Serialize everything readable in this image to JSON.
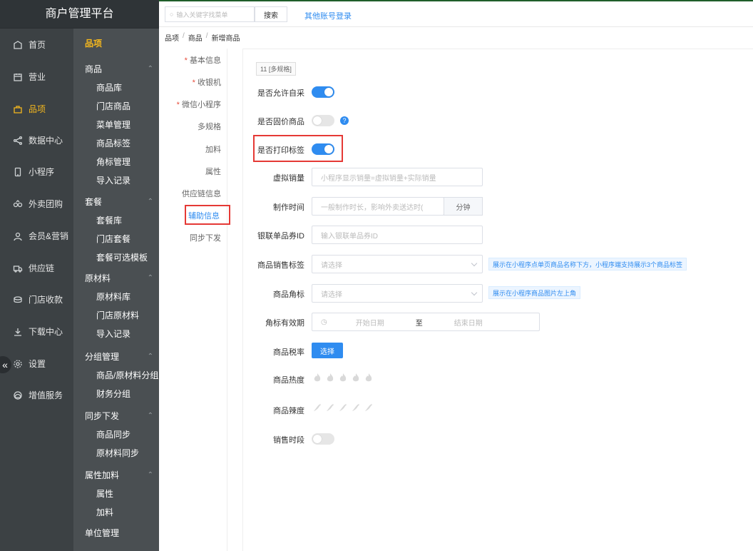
{
  "app": {
    "title": "商户管理平台"
  },
  "left_nav": [
    {
      "label": "首页",
      "icon": "home-icon"
    },
    {
      "label": "营业",
      "icon": "calendar-icon"
    },
    {
      "label": "品项",
      "icon": "bag-icon",
      "active": true
    },
    {
      "label": "数据中心",
      "icon": "share-icon"
    },
    {
      "label": "小程序",
      "icon": "phone-icon"
    },
    {
      "label": "外卖团购",
      "icon": "group-icon"
    },
    {
      "label": "会员&营销",
      "icon": "user-icon"
    },
    {
      "label": "供应链",
      "icon": "truck-icon"
    },
    {
      "label": "门店收款",
      "icon": "wallet-icon"
    },
    {
      "label": "下载中心",
      "icon": "download-icon"
    },
    {
      "label": "设置",
      "icon": "gear-icon"
    },
    {
      "label": "增值服务",
      "icon": "bell-icon"
    }
  ],
  "sub_nav": {
    "title": "品项",
    "groups": [
      {
        "label": "商品",
        "items": [
          "商品库",
          "门店商品",
          "菜单管理",
          "商品标签",
          "角标管理",
          "导入记录"
        ]
      },
      {
        "label": "套餐",
        "items": [
          "套餐库",
          "门店套餐",
          "套餐可选模板"
        ]
      },
      {
        "label": "原材料",
        "items": [
          "原材料库",
          "门店原材料",
          "导入记录"
        ]
      },
      {
        "label": "分组管理",
        "items": [
          "商品/原材料分组",
          "财务分组"
        ]
      },
      {
        "label": "同步下发",
        "items": [
          "商品同步",
          "原材料同步"
        ]
      },
      {
        "label": "属性加料",
        "items": [
          "属性",
          "加料"
        ]
      }
    ],
    "last": "单位管理"
  },
  "topbar": {
    "search_placeholder": "输入关键字找菜单",
    "search_button": "搜索",
    "other_login": "其他账号登录"
  },
  "breadcrumb": [
    "品项",
    "商品",
    "新增商品"
  ],
  "tabs": [
    {
      "label": "基本信息",
      "required": true
    },
    {
      "label": "收银机",
      "required": true
    },
    {
      "label": "微信小程序",
      "required": true
    },
    {
      "label": "多规格",
      "required": false
    },
    {
      "label": "加料",
      "required": false
    },
    {
      "label": "属性",
      "required": false
    },
    {
      "label": "供应链信息",
      "required": false
    },
    {
      "label": "辅助信息",
      "required": false,
      "active": true
    },
    {
      "label": "同步下发",
      "required": false
    }
  ],
  "form": {
    "spec_tag": "11 [多规格]",
    "allow_self_purchase": {
      "label": "是否允许自采",
      "on": true
    },
    "fixed_price": {
      "label": "是否固价商品",
      "on": false
    },
    "print_label": {
      "label": "是否打印标签",
      "on": true
    },
    "virtual_sales": {
      "label": "虚拟销量",
      "placeholder": "小程序显示销量=虚拟销量+实际销量"
    },
    "make_time": {
      "label": "制作时间",
      "placeholder": "一般制作时长，影响外卖送达时(",
      "unit": "分钟"
    },
    "unionpay_id": {
      "label": "银联单品券ID",
      "placeholder": "输入银联单品券ID"
    },
    "sales_tag": {
      "label": "商品销售标签",
      "placeholder": "请选择",
      "hint": "展示在小程序点单页商品名称下方，小程序端支持展示3个商品标签"
    },
    "corner_mark": {
      "label": "商品角标",
      "placeholder": "请选择",
      "hint": "展示在小程序商品图片左上角"
    },
    "corner_validity": {
      "label": "角标有效期",
      "start": "开始日期",
      "to": "至",
      "end": "结束日期"
    },
    "tax_rate": {
      "label": "商品税率",
      "button": "选择"
    },
    "heat": {
      "label": "商品热度",
      "count": 5
    },
    "spicy": {
      "label": "商品辣度",
      "count": 5
    },
    "sale_period": {
      "label": "销售时段",
      "on": false
    }
  },
  "colors": {
    "accent": "#2f8cf0",
    "active_nav": "#f6b81d",
    "highlight": "#e53935"
  }
}
